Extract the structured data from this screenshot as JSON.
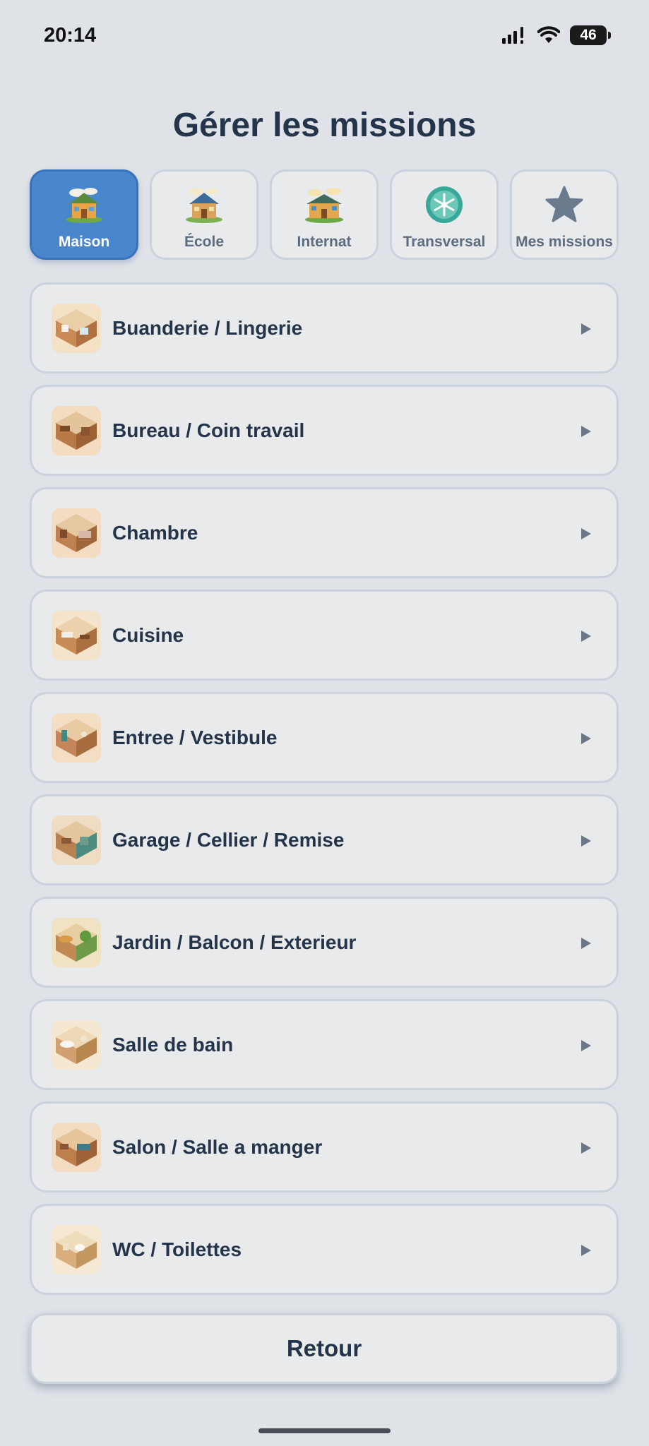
{
  "status": {
    "time": "20:14",
    "battery": "46"
  },
  "title": "Gérer les missions",
  "tabs": [
    {
      "label": "Maison",
      "icon": "house-icon",
      "active": true
    },
    {
      "label": "École",
      "icon": "school-icon",
      "active": false
    },
    {
      "label": "Internat",
      "icon": "boarding-house-icon",
      "active": false
    },
    {
      "label": "Transversal",
      "icon": "snowflake-badge-icon",
      "active": false
    },
    {
      "label": "Mes missions",
      "icon": "star-icon",
      "active": false
    }
  ],
  "rooms": [
    {
      "label": "Buanderie / Lingerie",
      "icon": "laundry-room-icon"
    },
    {
      "label": "Bureau / Coin travail",
      "icon": "office-room-icon"
    },
    {
      "label": "Chambre",
      "icon": "bedroom-icon"
    },
    {
      "label": "Cuisine",
      "icon": "kitchen-icon"
    },
    {
      "label": "Entree / Vestibule",
      "icon": "entrance-icon"
    },
    {
      "label": "Garage / Cellier / Remise",
      "icon": "garage-icon"
    },
    {
      "label": "Jardin / Balcon / Exterieur",
      "icon": "garden-icon"
    },
    {
      "label": "Salle de bain",
      "icon": "bathroom-icon"
    },
    {
      "label": "Salon / Salle a manger",
      "icon": "living-room-icon"
    },
    {
      "label": "WC / Toilettes",
      "icon": "toilet-icon"
    }
  ],
  "back_label": "Retour",
  "colors": {
    "background": "#dfe3e8",
    "accent": "#4a86cc",
    "text": "#24344a",
    "card": "#e9eaeb",
    "border": "#c9d2dd"
  }
}
